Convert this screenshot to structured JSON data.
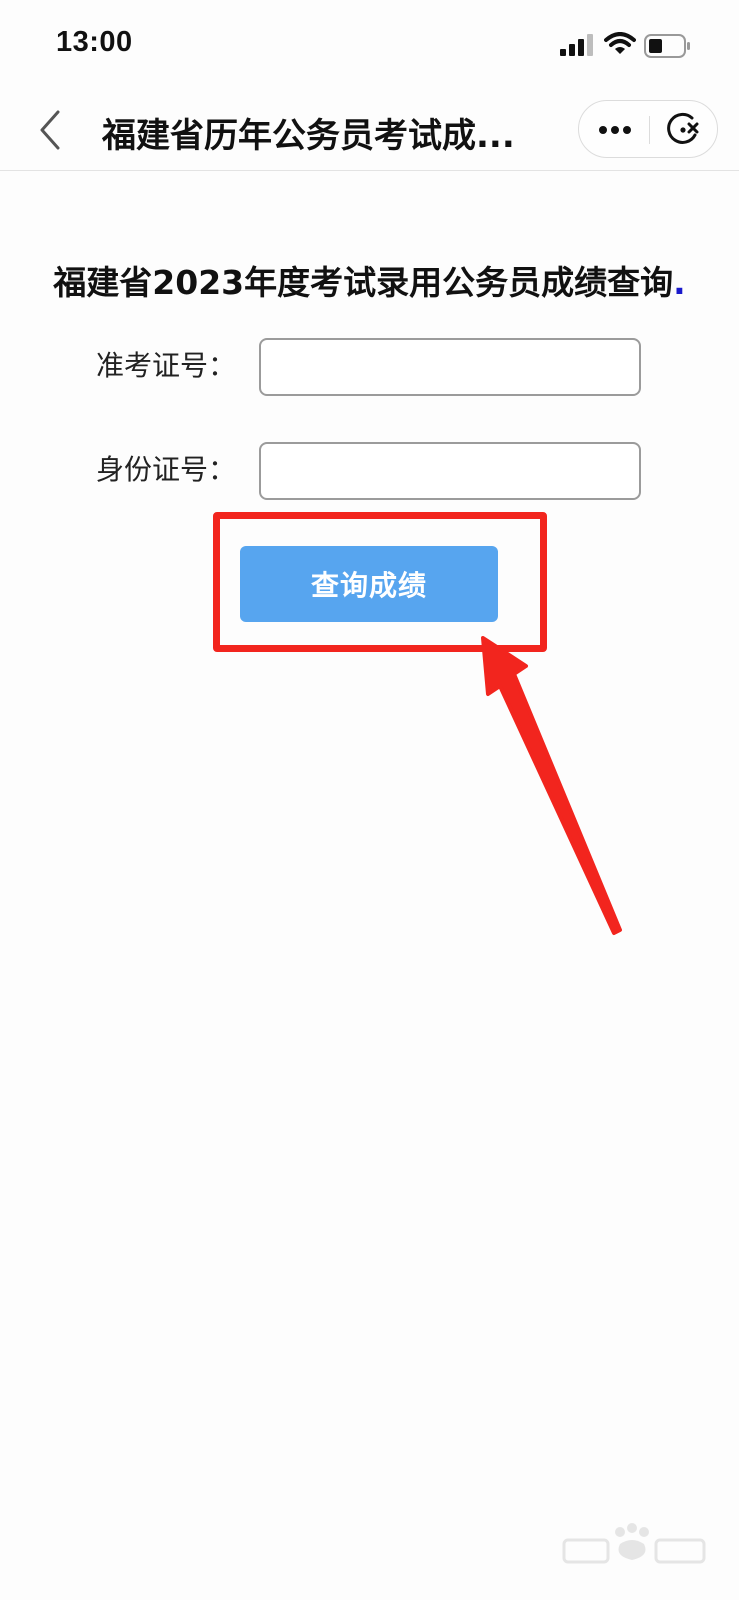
{
  "status_bar": {
    "time": "13:00"
  },
  "nav": {
    "title": "福建省历年公务员考试成...",
    "back_icon": "chevron-left-icon",
    "more_icon": "more-dots-icon",
    "close_icon": "close-miniprogram-icon"
  },
  "main": {
    "heading": "福建省2023年度考试录用公务员成绩查询",
    "heading_suffix": ".",
    "fields": [
      {
        "label": "准考证号：",
        "value": "",
        "placeholder": ""
      },
      {
        "label": "身份证号：",
        "value": "",
        "placeholder": ""
      }
    ],
    "submit_label": "查询成绩"
  },
  "annotation": {
    "color": "#f2251e"
  },
  "colors": {
    "button": "#57a5ef",
    "heading_dot": "#1a1acc"
  }
}
